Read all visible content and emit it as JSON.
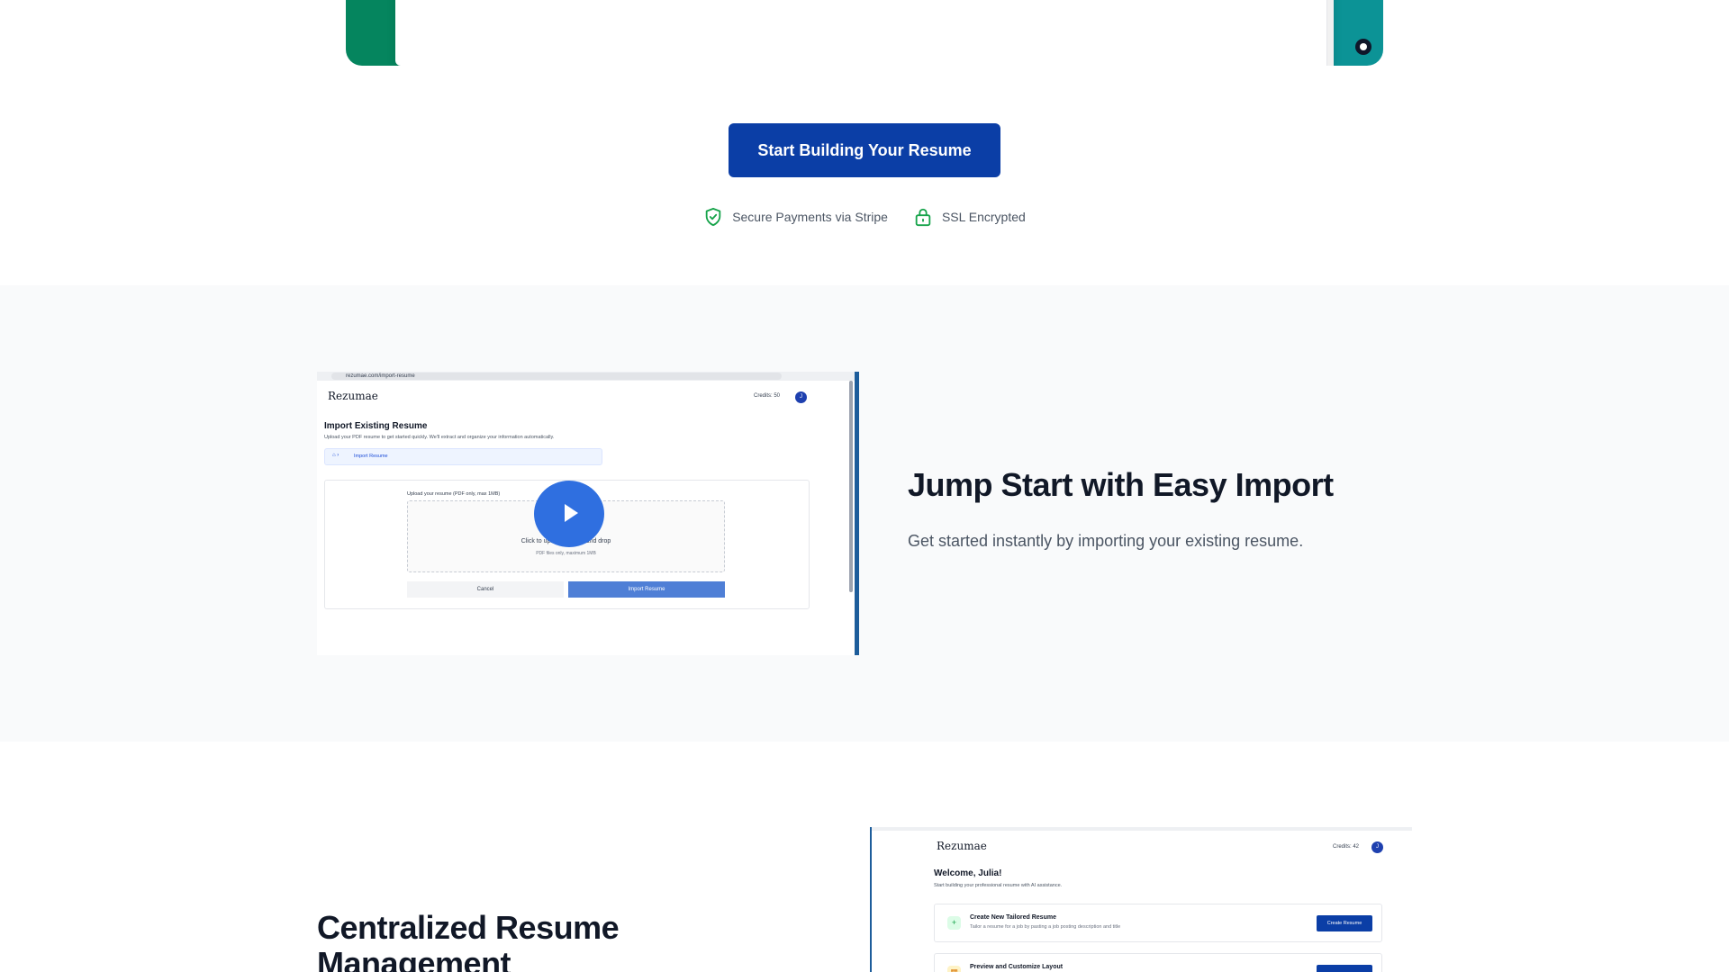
{
  "cta": {
    "label": "Start Building Your Resume"
  },
  "trust": {
    "secure": "Secure Payments via Stripe",
    "ssl": "SSL Encrypted"
  },
  "feature1": {
    "heading": "Jump Start with Easy Import",
    "description": "Get started instantly by importing your existing resume.",
    "mock": {
      "url": "rezumae.com/import-resume",
      "logo": "Rezumae",
      "credits": "Credits: 50",
      "avatar": "J",
      "title": "Import Existing Resume",
      "subtitle": "Upload your PDF resume to get started quickly. We'll extract and organize your information automatically.",
      "breadcrumb": "Import Resume",
      "upload_label": "Upload your resume (PDF only, max 1MB)",
      "drop_main": "Click to upload or drag and drop",
      "drop_sub": "PDF files only, maximum 1MB",
      "cancel": "Cancel",
      "import": "Import Resume"
    }
  },
  "feature2": {
    "heading": "Centralized Resume Management",
    "mock": {
      "logo": "Rezumae",
      "credits": "Credits: 42",
      "avatar": "J",
      "welcome": "Welcome, Julia!",
      "subtitle": "Start building your professional resume with AI assistance.",
      "items": [
        {
          "title": "Create New Tailored Resume",
          "desc": "Tailor a resume for a job by pasting a job posting description and title",
          "button": "Create Resume"
        },
        {
          "title": "Preview and Customize Layout",
          "desc": "",
          "button": ""
        }
      ]
    }
  },
  "colors": {
    "primary": "#0b3ea6",
    "frame_green": "#05855e",
    "frame_teal": "#0c9396",
    "trust_green": "#16a34a",
    "section_bg": "#f9fafb"
  },
  "icons": {
    "secure": "shield-check-icon",
    "ssl": "lock-icon",
    "video": "play-icon"
  }
}
